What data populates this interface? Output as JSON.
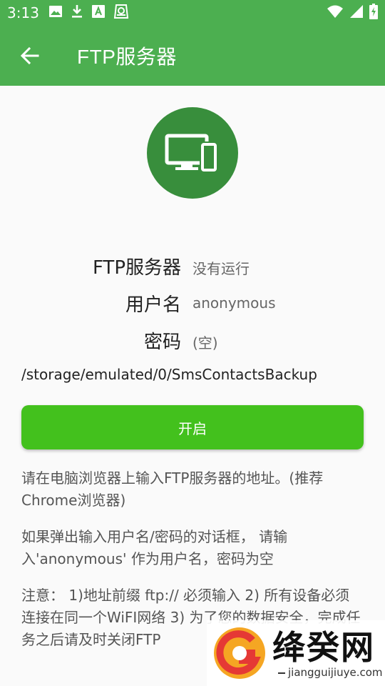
{
  "status_bar": {
    "time": "3:13",
    "left_icons": [
      "image-icon",
      "download-icon",
      "font-icon",
      "storage-icon"
    ],
    "right_icons": [
      "wifi-icon",
      "signal-icon",
      "battery-icon"
    ]
  },
  "app_bar": {
    "title": "FTP服务器",
    "back_icon": "arrow-back-icon",
    "color": "#4caf50"
  },
  "hero": {
    "icon": "devices-icon",
    "color": "#388e3c"
  },
  "info": {
    "server_label": "FTP服务器",
    "server_status": "没有运行",
    "user_label": "用户名",
    "user_value": "anonymous",
    "password_label": "密码",
    "password_value": "(空)"
  },
  "path": "/storage/emulated/0/SmsContactsBackup",
  "start_button": {
    "label": "开启",
    "color": "#43c11d"
  },
  "notes": {
    "browser_tip": "请在电脑浏览器上输入FTP服务器的地址。(推荐Chrome浏览器)",
    "login_tip": "如果弹出输入用户名/密码的对话框， 请输入'anonymous' 作为用户名，密码为空",
    "warning": "注意： 1)地址前缀 ftp:// 必须输入 2) 所有设备必须连接在同一个WiFI网络 3) 为了您的数据安全，完成任务之后请及时关闭FTP"
  },
  "watermark": {
    "text": "绛癸网",
    "url": "jiangguijiuye.com"
  }
}
